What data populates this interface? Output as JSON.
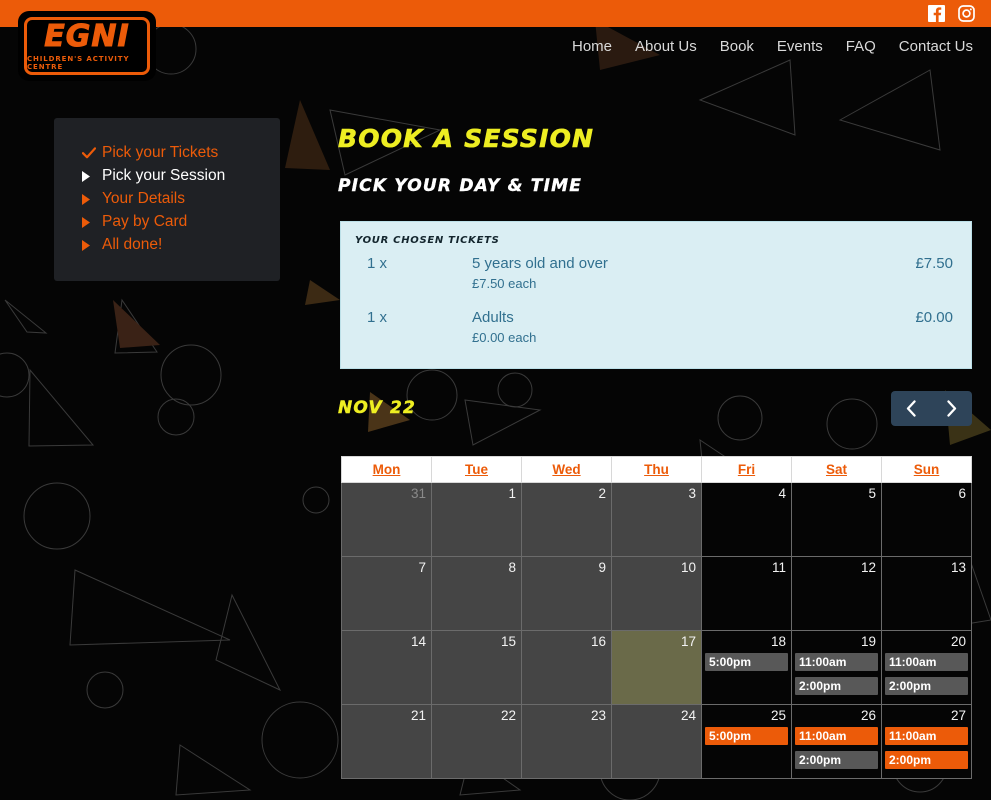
{
  "brand": {
    "logo_text": "EGNI",
    "logo_tagline": "CHILDREN'S ACTIVITY CENTRE",
    "accent_orange": "#ec5b09",
    "accent_yellow": "#eeee22"
  },
  "topbar": {
    "social": [
      {
        "name": "facebook-icon",
        "label": "Facebook"
      },
      {
        "name": "instagram-icon",
        "label": "Instagram"
      }
    ]
  },
  "nav": {
    "items": [
      {
        "label": "Home"
      },
      {
        "label": "About Us"
      },
      {
        "label": "Book"
      },
      {
        "label": "Events"
      },
      {
        "label": "FAQ"
      },
      {
        "label": "Contact Us"
      }
    ]
  },
  "steps": [
    {
      "label": "Pick your Tickets",
      "state": "done",
      "mark": "check"
    },
    {
      "label": "Pick your Session",
      "state": "active",
      "mark": "arrow"
    },
    {
      "label": "Your Details",
      "state": "todo",
      "mark": "arrow"
    },
    {
      "label": "Pay by Card",
      "state": "todo",
      "mark": "arrow"
    },
    {
      "label": "All done!",
      "state": "todo",
      "mark": "arrow"
    }
  ],
  "headings": {
    "page_title": "BOOK A SESSION",
    "section_title": "PICK YOUR DAY & TIME"
  },
  "tickets": {
    "title": "YOUR CHOSEN TICKETS",
    "rows": [
      {
        "qty": "1 x",
        "name": "5 years old and over",
        "each": "£7.50 each",
        "amount": "£7.50"
      },
      {
        "qty": "1 x",
        "name": "Adults",
        "each": "£0.00 each",
        "amount": "£0.00"
      }
    ]
  },
  "calendar": {
    "month_label": "NOV 22",
    "prev_label": "Previous month",
    "next_label": "Next month",
    "weekdays": [
      "Mon",
      "Tue",
      "Wed",
      "Thu",
      "Fri",
      "Sat",
      "Sun"
    ],
    "weeks": [
      [
        {
          "day": "31",
          "muted": true,
          "tone": "grey",
          "events": []
        },
        {
          "day": "1",
          "muted": false,
          "tone": "grey",
          "events": []
        },
        {
          "day": "2",
          "muted": false,
          "tone": "grey",
          "events": []
        },
        {
          "day": "3",
          "muted": false,
          "tone": "grey",
          "events": []
        },
        {
          "day": "4",
          "muted": false,
          "tone": "black",
          "events": []
        },
        {
          "day": "5",
          "muted": false,
          "tone": "black",
          "events": []
        },
        {
          "day": "6",
          "muted": false,
          "tone": "black",
          "events": []
        }
      ],
      [
        {
          "day": "7",
          "muted": false,
          "tone": "grey",
          "events": []
        },
        {
          "day": "8",
          "muted": false,
          "tone": "grey",
          "events": []
        },
        {
          "day": "9",
          "muted": false,
          "tone": "grey",
          "events": []
        },
        {
          "day": "10",
          "muted": false,
          "tone": "grey",
          "events": []
        },
        {
          "day": "11",
          "muted": false,
          "tone": "black",
          "events": []
        },
        {
          "day": "12",
          "muted": false,
          "tone": "black",
          "events": []
        },
        {
          "day": "13",
          "muted": false,
          "tone": "black",
          "events": []
        }
      ],
      [
        {
          "day": "14",
          "muted": false,
          "tone": "grey",
          "events": []
        },
        {
          "day": "15",
          "muted": false,
          "tone": "grey",
          "events": []
        },
        {
          "day": "16",
          "muted": false,
          "tone": "grey",
          "events": []
        },
        {
          "day": "17",
          "muted": false,
          "tone": "today",
          "events": []
        },
        {
          "day": "18",
          "muted": false,
          "tone": "black",
          "events": [
            {
              "time": "5:00pm",
              "available": false
            }
          ]
        },
        {
          "day": "19",
          "muted": false,
          "tone": "black",
          "events": [
            {
              "time": "11:00am",
              "available": false
            },
            {
              "time": "2:00pm",
              "available": false
            }
          ]
        },
        {
          "day": "20",
          "muted": false,
          "tone": "black",
          "events": [
            {
              "time": "11:00am",
              "available": false
            },
            {
              "time": "2:00pm",
              "available": false
            }
          ]
        }
      ],
      [
        {
          "day": "21",
          "muted": false,
          "tone": "grey",
          "events": []
        },
        {
          "day": "22",
          "muted": false,
          "tone": "grey",
          "events": []
        },
        {
          "day": "23",
          "muted": false,
          "tone": "grey",
          "events": []
        },
        {
          "day": "24",
          "muted": false,
          "tone": "grey",
          "events": []
        },
        {
          "day": "25",
          "muted": false,
          "tone": "black",
          "events": [
            {
              "time": "5:00pm",
              "available": true
            }
          ]
        },
        {
          "day": "26",
          "muted": false,
          "tone": "black",
          "events": [
            {
              "time": "11:00am",
              "available": true
            },
            {
              "time": "2:00pm",
              "available": false
            }
          ]
        },
        {
          "day": "27",
          "muted": false,
          "tone": "black",
          "events": [
            {
              "time": "11:00am",
              "available": true
            },
            {
              "time": "2:00pm",
              "available": true
            }
          ]
        }
      ]
    ]
  }
}
